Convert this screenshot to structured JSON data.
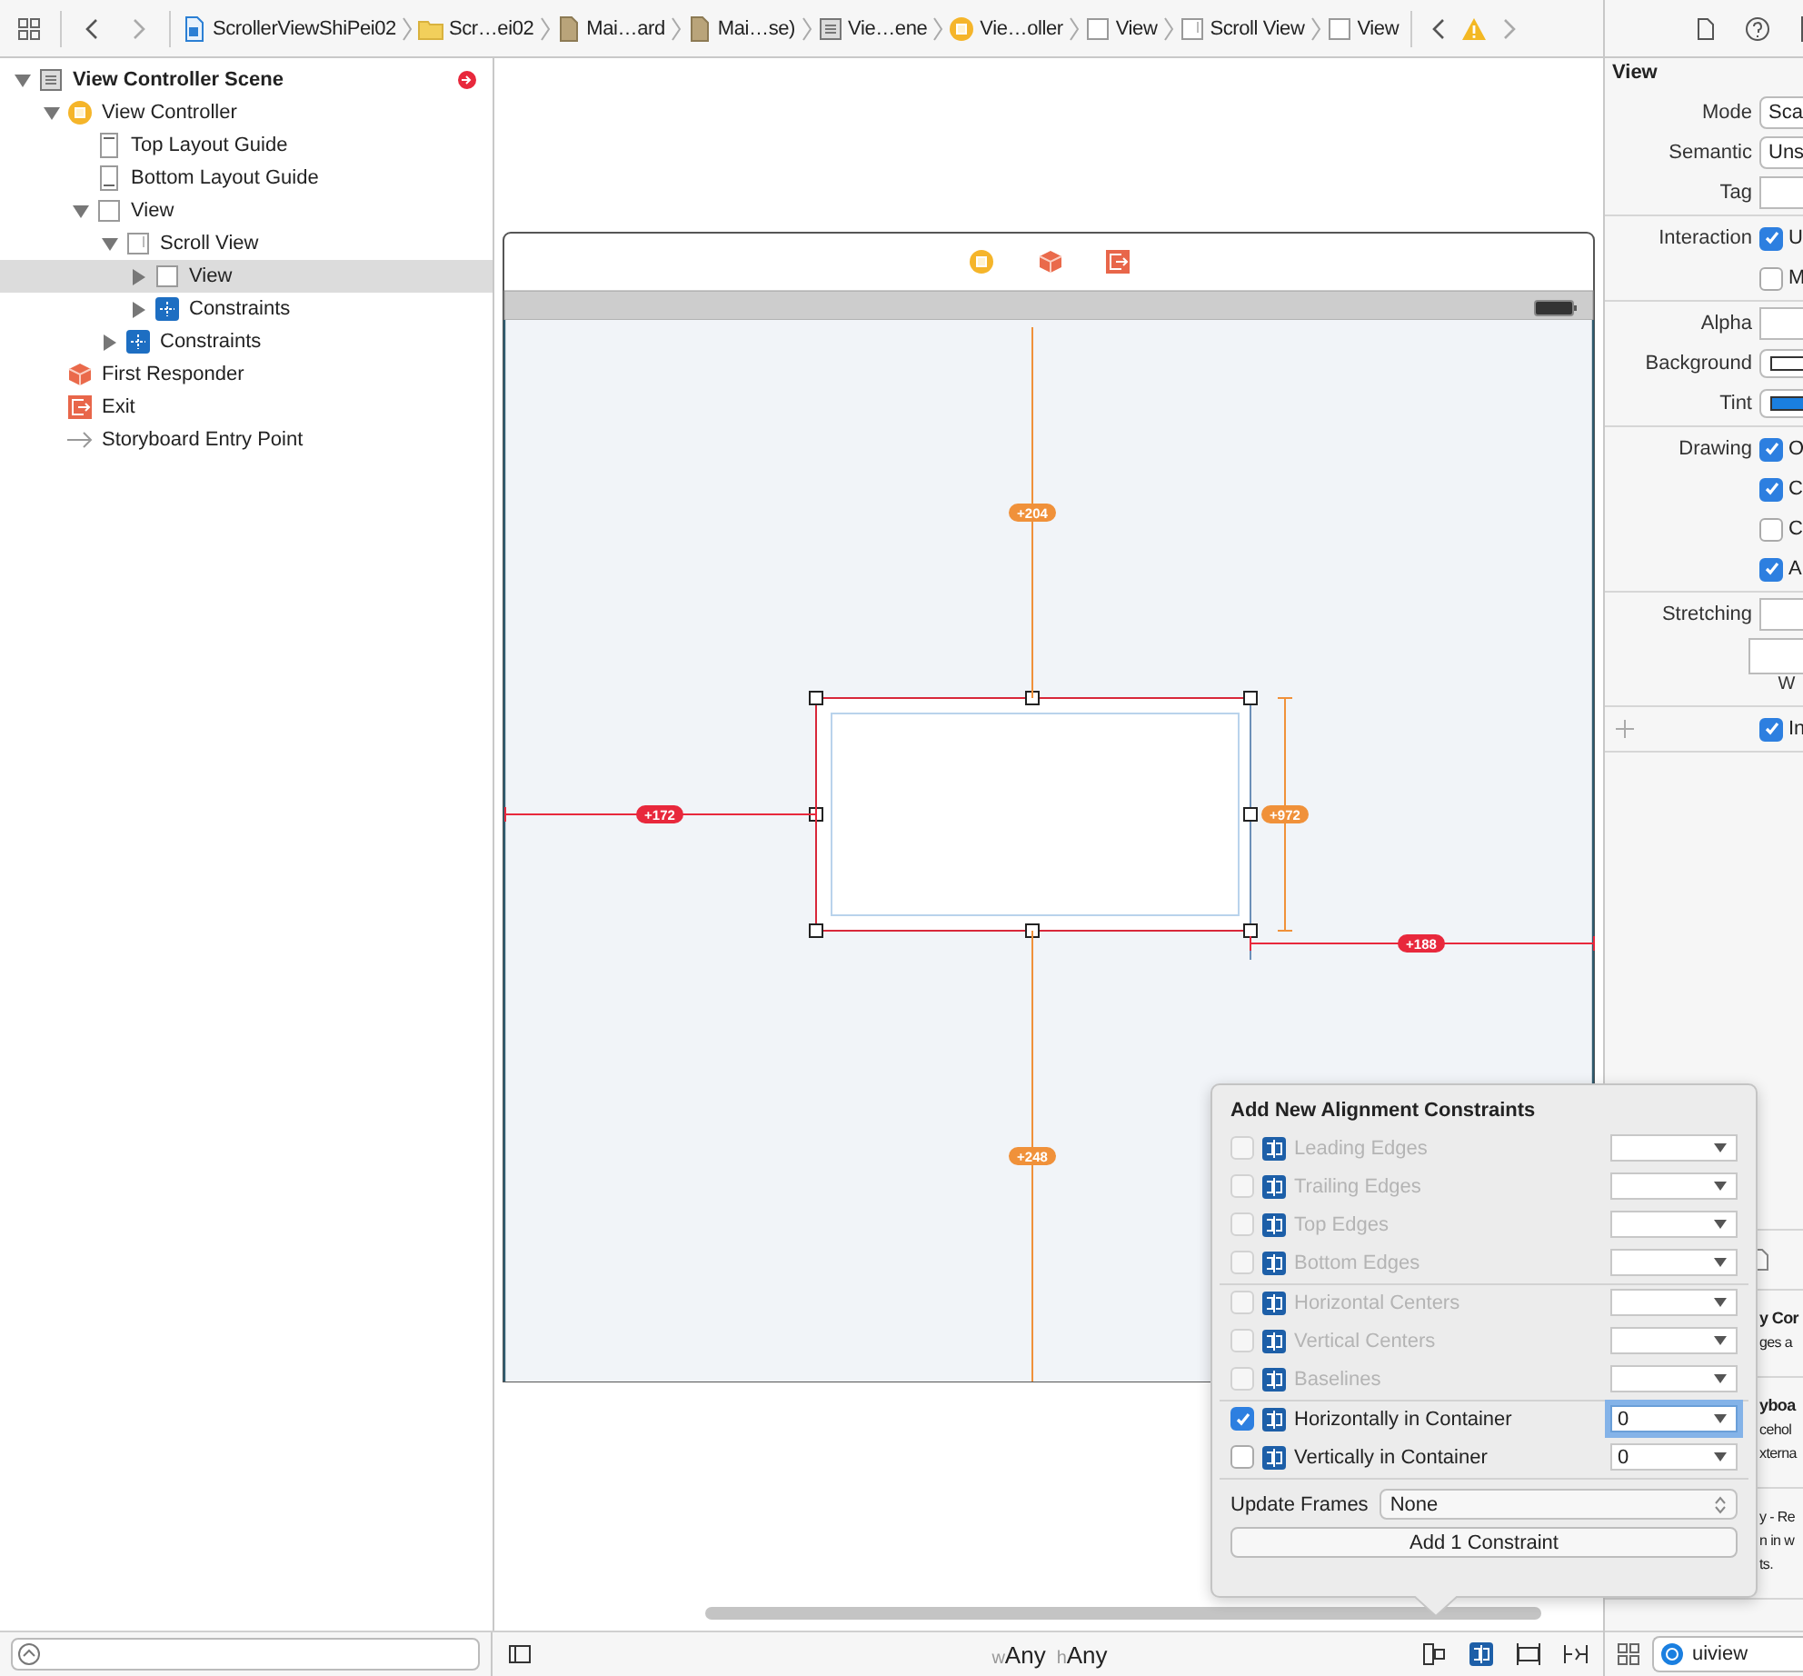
{
  "toolbar": {
    "breadcrumbs": [
      {
        "kind": "project",
        "label": "ScrollerViewShiPei02"
      },
      {
        "kind": "folder",
        "label": "Scr…ei02"
      },
      {
        "kind": "file",
        "label": "Mai…ard"
      },
      {
        "kind": "file",
        "label": "Mai…se)"
      },
      {
        "kind": "scene",
        "label": "Vie…ene"
      },
      {
        "kind": "vc",
        "label": "Vie…oller"
      },
      {
        "kind": "view",
        "label": "View"
      },
      {
        "kind": "scroll",
        "label": "Scroll View"
      },
      {
        "kind": "view",
        "label": "View"
      }
    ]
  },
  "outline": [
    {
      "kind": "scene",
      "label": "View Controller Scene",
      "expanded": true,
      "selected": false,
      "children": [
        {
          "kind": "vc",
          "label": "View Controller",
          "expanded": true,
          "selected": false,
          "children": [
            {
              "kind": "guide-top",
              "label": "Top Layout Guide",
              "selected": false
            },
            {
              "kind": "guide-bottom",
              "label": "Bottom Layout Guide",
              "selected": false
            },
            {
              "kind": "view",
              "label": "View",
              "expanded": true,
              "selected": false,
              "children": [
                {
                  "kind": "scroll",
                  "label": "Scroll View",
                  "expanded": true,
                  "selected": false,
                  "children": [
                    {
                      "kind": "view",
                      "label": "View",
                      "expanded": false,
                      "selected": true
                    },
                    {
                      "kind": "constraints",
                      "label": "Constraints",
                      "expanded": false,
                      "selected": false
                    }
                  ]
                },
                {
                  "kind": "constraints",
                  "label": "Constraints",
                  "expanded": false,
                  "selected": false
                }
              ]
            }
          ]
        },
        {
          "kind": "responder",
          "label": "First Responder",
          "selected": false
        },
        {
          "kind": "exit",
          "label": "Exit",
          "selected": false
        },
        {
          "kind": "entry",
          "label": "Storyboard Entry Point",
          "selected": false
        }
      ]
    }
  ],
  "canvas": {
    "constraints": [
      {
        "label": "+204",
        "color": "#f0913a"
      },
      {
        "label": "+248",
        "color": "#f0913a"
      },
      {
        "label": "+172",
        "color": "#e8283c"
      },
      {
        "label": "+972",
        "color": "#f0913a"
      },
      {
        "label": "+188",
        "color": "#e8283c"
      }
    ]
  },
  "inspector": {
    "title": "View",
    "sections": [
      [
        {
          "kind": "select",
          "label": "Mode",
          "value": "Sca"
        },
        {
          "kind": "select",
          "label": "Semantic",
          "value": "Uns"
        },
        {
          "kind": "field",
          "label": "Tag"
        }
      ],
      [
        {
          "kind": "check",
          "label": "Interaction",
          "text": "U",
          "checked": true
        },
        {
          "kind": "check",
          "text": "M",
          "checked": false
        }
      ],
      [
        {
          "kind": "field",
          "label": "Alpha"
        },
        {
          "kind": "well",
          "label": "Background",
          "color": "#ffffff"
        },
        {
          "kind": "well",
          "label": "Tint",
          "color": "#1a7fe0"
        }
      ],
      [
        {
          "kind": "check",
          "label": "Drawing",
          "text": "O",
          "checked": true
        },
        {
          "kind": "check",
          "text": "C",
          "checked": true
        },
        {
          "kind": "check",
          "text": "C",
          "checked": false
        },
        {
          "kind": "check",
          "text": "A",
          "checked": true
        }
      ],
      [
        {
          "kind": "field",
          "label": "Stretching"
        },
        {
          "kind": "caption-field",
          "caption": "W"
        }
      ],
      [
        {
          "kind": "plus-check",
          "text": "In",
          "checked": true
        }
      ]
    ],
    "lower_sections": [
      {
        "title": "y Cor",
        "lines": [
          "ges a"
        ]
      },
      {
        "title": "yboa",
        "lines": [
          "cehol",
          "xterna"
        ]
      },
      {
        "lines": [
          "y - Re",
          "n in w",
          "ts."
        ]
      }
    ]
  },
  "popover": {
    "title": "Add New Alignment Constraints",
    "sections": [
      [
        {
          "label": "Leading Edges",
          "checked": false,
          "disabled": true,
          "focused": false
        },
        {
          "label": "Trailing Edges",
          "checked": false,
          "disabled": true,
          "focused": false
        },
        {
          "label": "Top Edges",
          "checked": false,
          "disabled": true,
          "focused": false
        },
        {
          "label": "Bottom Edges",
          "checked": false,
          "disabled": true,
          "focused": false
        }
      ],
      [
        {
          "label": "Horizontal Centers",
          "checked": false,
          "disabled": true,
          "focused": false
        },
        {
          "label": "Vertical Centers",
          "checked": false,
          "disabled": true,
          "focused": false
        },
        {
          "label": "Baselines",
          "checked": false,
          "disabled": true,
          "focused": false
        }
      ],
      [
        {
          "label": "Horizontally in Container",
          "checked": true,
          "disabled": false,
          "value": "0",
          "focused": true
        },
        {
          "label": "Vertically in Container",
          "checked": false,
          "disabled": false,
          "value": "0",
          "focused": false
        }
      ]
    ],
    "update_frames_label": "Update Frames",
    "update_frames_value": "None",
    "add_button": "Add 1 Constraint"
  },
  "bottom_bar": {
    "width_prefix": "w",
    "width_class": "Any",
    "height_prefix": "h",
    "height_class": "Any",
    "library_search": "uiview"
  }
}
